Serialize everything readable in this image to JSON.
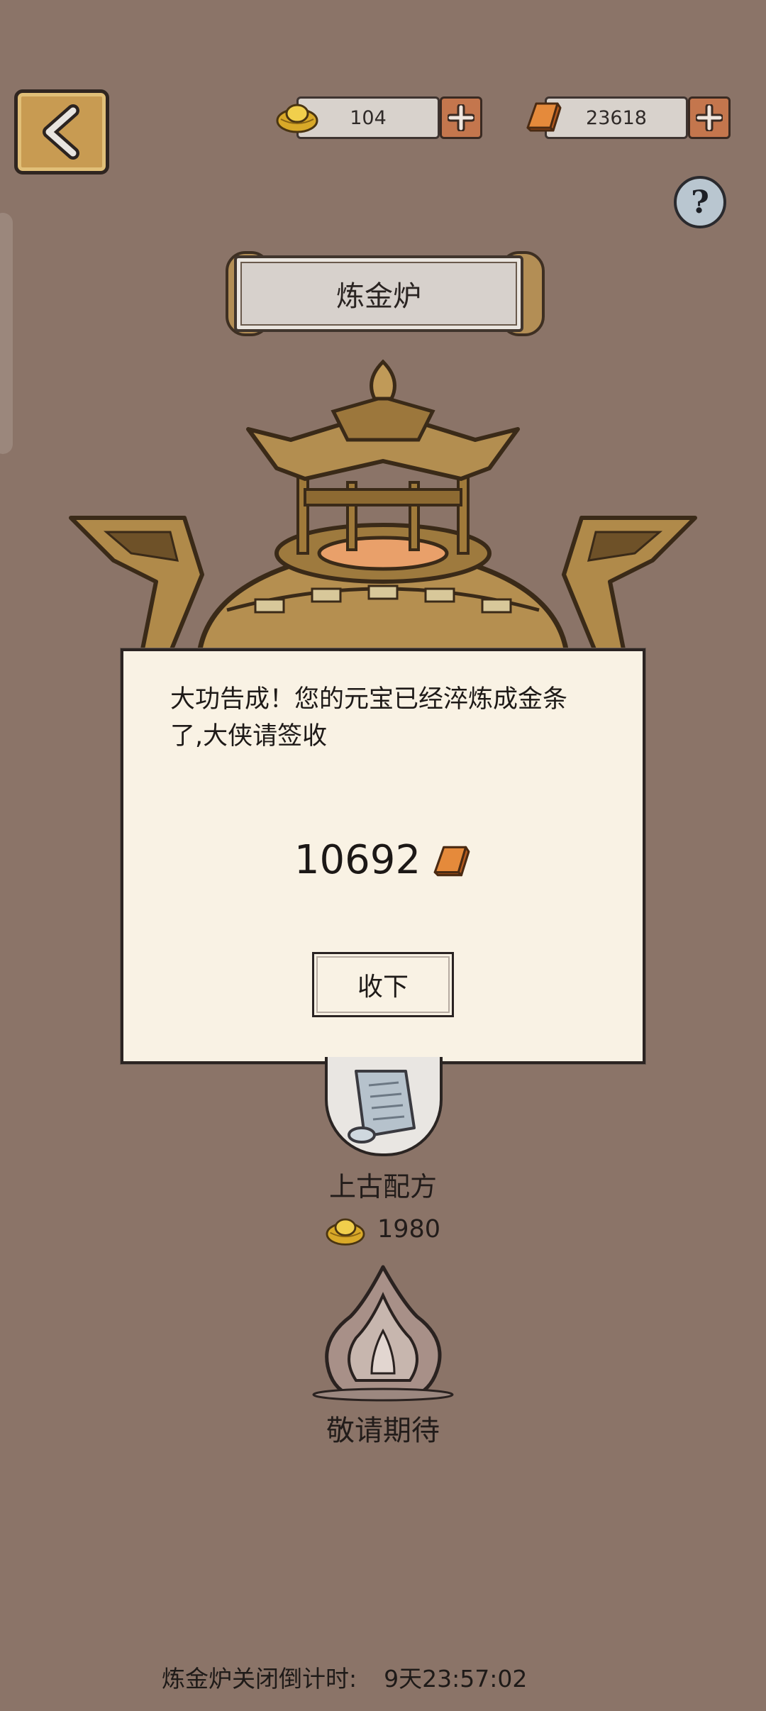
{
  "header": {
    "back_icon": "chevron-left-icon",
    "ingot_currency": {
      "value": "104",
      "icon": "gold-ingot-icon"
    },
    "gold_bar_currency": {
      "value": "23618",
      "icon": "gold-bar-icon"
    },
    "help_label": "?"
  },
  "title": "炼金炉",
  "furnace_icon": "alchemy-furnace-icon",
  "dialog": {
    "message": "大功告成！您的元宝已经淬炼成金条了,大侠请签收",
    "amount": "10692",
    "amount_icon": "gold-bar-icon",
    "button_label": "收下"
  },
  "recipe": {
    "icon": "scroll-icon",
    "label": "上古配方",
    "cost": "1980",
    "cost_icon": "gold-ingot-icon"
  },
  "coming_soon": {
    "icon": "flame-icon",
    "label": "敬请期待"
  },
  "countdown": {
    "label": "炼金炉关闭倒计时:",
    "value": "9天23:57:02"
  },
  "colors": {
    "background": "#8b7468",
    "dialog_bg": "#f9f2e4",
    "bronze": "#b08a4a",
    "plus_orange": "#c4764d"
  }
}
